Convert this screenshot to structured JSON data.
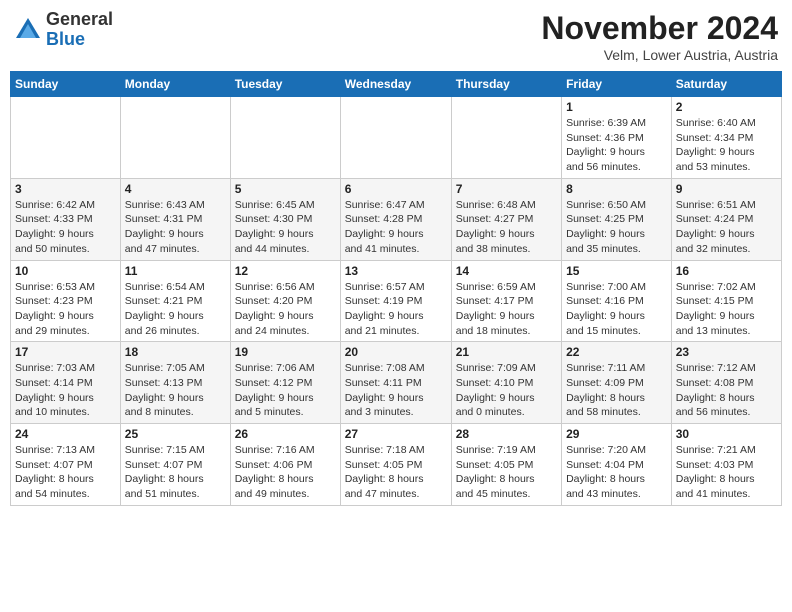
{
  "header": {
    "logo": {
      "general": "General",
      "blue": "Blue"
    },
    "title": "November 2024",
    "location": "Velm, Lower Austria, Austria"
  },
  "weekdays": [
    "Sunday",
    "Monday",
    "Tuesday",
    "Wednesday",
    "Thursday",
    "Friday",
    "Saturday"
  ],
  "weeks": [
    [
      {
        "day": "",
        "info": ""
      },
      {
        "day": "",
        "info": ""
      },
      {
        "day": "",
        "info": ""
      },
      {
        "day": "",
        "info": ""
      },
      {
        "day": "",
        "info": ""
      },
      {
        "day": "1",
        "info": "Sunrise: 6:39 AM\nSunset: 4:36 PM\nDaylight: 9 hours\nand 56 minutes."
      },
      {
        "day": "2",
        "info": "Sunrise: 6:40 AM\nSunset: 4:34 PM\nDaylight: 9 hours\nand 53 minutes."
      }
    ],
    [
      {
        "day": "3",
        "info": "Sunrise: 6:42 AM\nSunset: 4:33 PM\nDaylight: 9 hours\nand 50 minutes."
      },
      {
        "day": "4",
        "info": "Sunrise: 6:43 AM\nSunset: 4:31 PM\nDaylight: 9 hours\nand 47 minutes."
      },
      {
        "day": "5",
        "info": "Sunrise: 6:45 AM\nSunset: 4:30 PM\nDaylight: 9 hours\nand 44 minutes."
      },
      {
        "day": "6",
        "info": "Sunrise: 6:47 AM\nSunset: 4:28 PM\nDaylight: 9 hours\nand 41 minutes."
      },
      {
        "day": "7",
        "info": "Sunrise: 6:48 AM\nSunset: 4:27 PM\nDaylight: 9 hours\nand 38 minutes."
      },
      {
        "day": "8",
        "info": "Sunrise: 6:50 AM\nSunset: 4:25 PM\nDaylight: 9 hours\nand 35 minutes."
      },
      {
        "day": "9",
        "info": "Sunrise: 6:51 AM\nSunset: 4:24 PM\nDaylight: 9 hours\nand 32 minutes."
      }
    ],
    [
      {
        "day": "10",
        "info": "Sunrise: 6:53 AM\nSunset: 4:23 PM\nDaylight: 9 hours\nand 29 minutes."
      },
      {
        "day": "11",
        "info": "Sunrise: 6:54 AM\nSunset: 4:21 PM\nDaylight: 9 hours\nand 26 minutes."
      },
      {
        "day": "12",
        "info": "Sunrise: 6:56 AM\nSunset: 4:20 PM\nDaylight: 9 hours\nand 24 minutes."
      },
      {
        "day": "13",
        "info": "Sunrise: 6:57 AM\nSunset: 4:19 PM\nDaylight: 9 hours\nand 21 minutes."
      },
      {
        "day": "14",
        "info": "Sunrise: 6:59 AM\nSunset: 4:17 PM\nDaylight: 9 hours\nand 18 minutes."
      },
      {
        "day": "15",
        "info": "Sunrise: 7:00 AM\nSunset: 4:16 PM\nDaylight: 9 hours\nand 15 minutes."
      },
      {
        "day": "16",
        "info": "Sunrise: 7:02 AM\nSunset: 4:15 PM\nDaylight: 9 hours\nand 13 minutes."
      }
    ],
    [
      {
        "day": "17",
        "info": "Sunrise: 7:03 AM\nSunset: 4:14 PM\nDaylight: 9 hours\nand 10 minutes."
      },
      {
        "day": "18",
        "info": "Sunrise: 7:05 AM\nSunset: 4:13 PM\nDaylight: 9 hours\nand 8 minutes."
      },
      {
        "day": "19",
        "info": "Sunrise: 7:06 AM\nSunset: 4:12 PM\nDaylight: 9 hours\nand 5 minutes."
      },
      {
        "day": "20",
        "info": "Sunrise: 7:08 AM\nSunset: 4:11 PM\nDaylight: 9 hours\nand 3 minutes."
      },
      {
        "day": "21",
        "info": "Sunrise: 7:09 AM\nSunset: 4:10 PM\nDaylight: 9 hours\nand 0 minutes."
      },
      {
        "day": "22",
        "info": "Sunrise: 7:11 AM\nSunset: 4:09 PM\nDaylight: 8 hours\nand 58 minutes."
      },
      {
        "day": "23",
        "info": "Sunrise: 7:12 AM\nSunset: 4:08 PM\nDaylight: 8 hours\nand 56 minutes."
      }
    ],
    [
      {
        "day": "24",
        "info": "Sunrise: 7:13 AM\nSunset: 4:07 PM\nDaylight: 8 hours\nand 54 minutes."
      },
      {
        "day": "25",
        "info": "Sunrise: 7:15 AM\nSunset: 4:07 PM\nDaylight: 8 hours\nand 51 minutes."
      },
      {
        "day": "26",
        "info": "Sunrise: 7:16 AM\nSunset: 4:06 PM\nDaylight: 8 hours\nand 49 minutes."
      },
      {
        "day": "27",
        "info": "Sunrise: 7:18 AM\nSunset: 4:05 PM\nDaylight: 8 hours\nand 47 minutes."
      },
      {
        "day": "28",
        "info": "Sunrise: 7:19 AM\nSunset: 4:05 PM\nDaylight: 8 hours\nand 45 minutes."
      },
      {
        "day": "29",
        "info": "Sunrise: 7:20 AM\nSunset: 4:04 PM\nDaylight: 8 hours\nand 43 minutes."
      },
      {
        "day": "30",
        "info": "Sunrise: 7:21 AM\nSunset: 4:03 PM\nDaylight: 8 hours\nand 41 minutes."
      }
    ]
  ]
}
